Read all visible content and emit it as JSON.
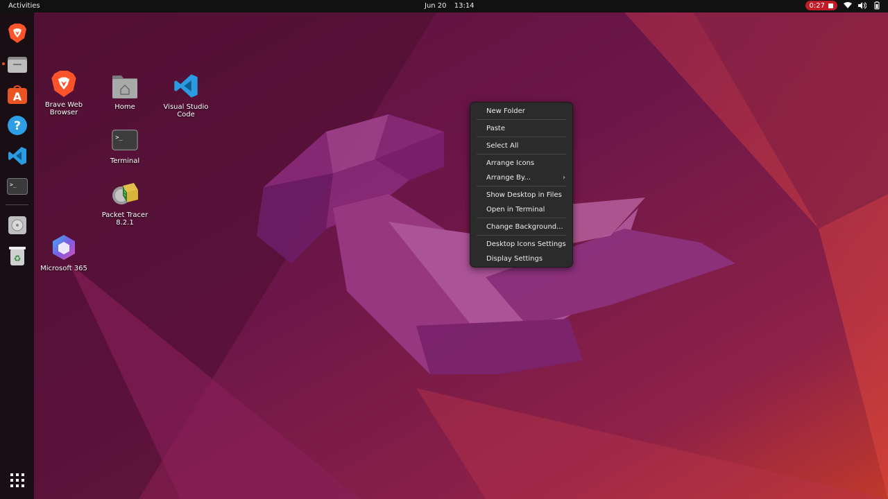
{
  "topbar": {
    "activities": "Activities",
    "date": "Jun 20",
    "time": "13:14",
    "recording_time": "0:27",
    "recording_color": "#c01c28"
  },
  "dock": {
    "items": [
      {
        "icon": "brave-icon"
      },
      {
        "icon": "files-icon",
        "running": true
      },
      {
        "icon": "app-center-icon"
      },
      {
        "icon": "help-icon"
      },
      {
        "icon": "vscode-icon"
      },
      {
        "icon": "terminal-icon"
      },
      {
        "icon": "disk-icon"
      },
      {
        "icon": "trash-icon"
      },
      {
        "icon": "show-apps-icon"
      }
    ]
  },
  "desktop": {
    "icons": [
      {
        "label": "Brave Web Browser",
        "icon": "brave-icon"
      },
      {
        "label": "Home",
        "icon": "home-folder-icon"
      },
      {
        "label": "Visual Studio Code",
        "icon": "vscode-icon"
      },
      {
        "label": "Terminal",
        "icon": "terminal-icon"
      },
      {
        "label": "Packet Tracer 8.2.1",
        "icon": "packet-tracer-icon"
      },
      {
        "label": "Microsoft 365",
        "icon": "microsoft-365-icon"
      }
    ]
  },
  "context_menu": {
    "items": [
      {
        "label": "New Folder"
      },
      {
        "label": "Paste"
      },
      {
        "label": "Select All"
      },
      {
        "label": "Arrange Icons"
      },
      {
        "label": "Arrange By...",
        "submenu_indicator": "›"
      },
      {
        "label": "Show Desktop in Files"
      },
      {
        "label": "Open in Terminal"
      },
      {
        "label": "Change Background..."
      },
      {
        "label": "Desktop Icons Settings"
      },
      {
        "label": "Display Settings"
      }
    ]
  },
  "colors": {
    "accent": "#e95420",
    "topbar": "#111111",
    "menu_bg": "#2b2b2b"
  }
}
